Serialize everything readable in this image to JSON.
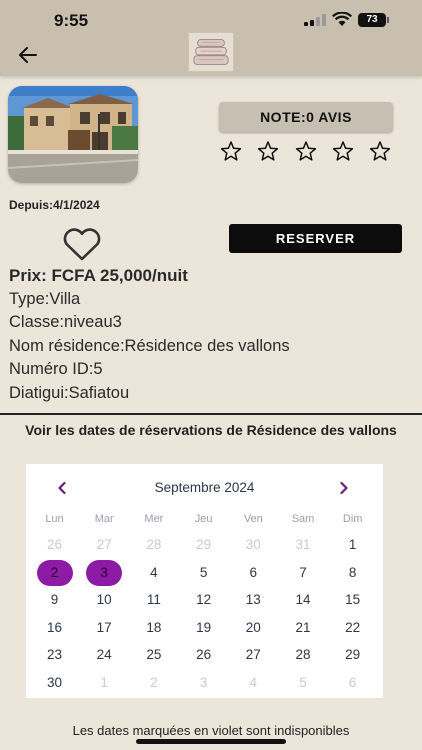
{
  "status_bar": {
    "time": "9:55",
    "battery": "73"
  },
  "header": {
    "back_icon": "arrow-left-icon",
    "logo_icon": "folded-towels-logo"
  },
  "listing": {
    "rating_label": "NOTE:0 AVIS",
    "stars_total": 5,
    "stars_filled": 0,
    "since": "Depuis:4/1/2024",
    "reserve_label": "RESERVER",
    "price": "Prix: FCFA 25,000/nuit",
    "type": "Type:Villa",
    "class": "Classe:niveau3",
    "residence": "Nom résidence:Résidence des vallons",
    "id": "Numéro ID:5",
    "owner": "Diatigui:Safiatou"
  },
  "calendar": {
    "title": "Voir les dates de réservations de Résidence des vallons",
    "month": "Septembre 2024",
    "weekdays": [
      "Lun",
      "Mar",
      "Mer",
      "Jeu",
      "Ven",
      "Sam",
      "Dim"
    ],
    "weeks": [
      [
        {
          "d": "26",
          "o": true
        },
        {
          "d": "27",
          "o": true
        },
        {
          "d": "28",
          "o": true
        },
        {
          "d": "29",
          "o": true
        },
        {
          "d": "30",
          "o": true
        },
        {
          "d": "31",
          "o": true
        },
        {
          "d": "1"
        }
      ],
      [
        {
          "d": "2",
          "b": true
        },
        {
          "d": "3",
          "b": true
        },
        {
          "d": "4"
        },
        {
          "d": "5"
        },
        {
          "d": "6"
        },
        {
          "d": "7"
        },
        {
          "d": "8"
        }
      ],
      [
        {
          "d": "9"
        },
        {
          "d": "10"
        },
        {
          "d": "11"
        },
        {
          "d": "12"
        },
        {
          "d": "13"
        },
        {
          "d": "14"
        },
        {
          "d": "15"
        }
      ],
      [
        {
          "d": "16"
        },
        {
          "d": "17"
        },
        {
          "d": "18"
        },
        {
          "d": "19"
        },
        {
          "d": "20"
        },
        {
          "d": "21"
        },
        {
          "d": "22"
        }
      ],
      [
        {
          "d": "23"
        },
        {
          "d": "24"
        },
        {
          "d": "25"
        },
        {
          "d": "26"
        },
        {
          "d": "27"
        },
        {
          "d": "28"
        },
        {
          "d": "29"
        }
      ],
      [
        {
          "d": "30"
        },
        {
          "d": "1",
          "o": true
        },
        {
          "d": "2",
          "o": true
        },
        {
          "d": "3",
          "o": true
        },
        {
          "d": "4",
          "o": true
        },
        {
          "d": "5",
          "o": true
        },
        {
          "d": "6",
          "o": true
        }
      ]
    ],
    "legend": "Les dates marquées en violet sont indisponibles"
  },
  "colors": {
    "background": "#ECE6DA",
    "header": "#C9BFAF",
    "booked": "#8E1BA6",
    "button": "#0C0C0C"
  }
}
